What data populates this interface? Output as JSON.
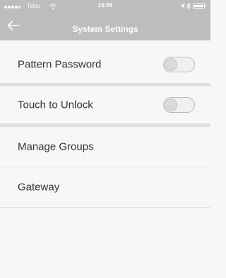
{
  "status_bar": {
    "carrier": "Telco",
    "time": "16:59"
  },
  "nav": {
    "title": "System Settings"
  },
  "settings": [
    {
      "label": "Pattern Password",
      "toggle_on": false
    },
    {
      "label": "Touch to Unlock",
      "toggle_on": false
    },
    {
      "label": "Manage Groups"
    },
    {
      "label": "Gateway"
    }
  ],
  "colors": {
    "header": "#bdbdbd",
    "background": "#f7f7f7",
    "text": "#333333"
  },
  "icons": [
    "signal-icon",
    "wifi-icon",
    "location-icon",
    "bluetooth-icon",
    "battery-icon",
    "back-arrow-icon"
  ]
}
